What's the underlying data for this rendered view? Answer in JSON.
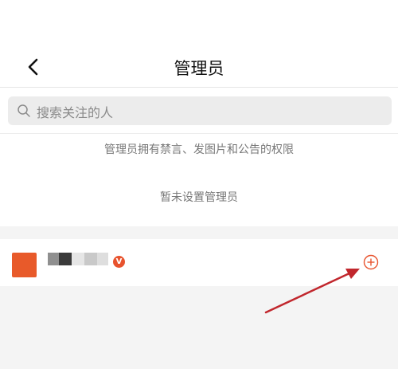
{
  "header": {
    "title": "管理员",
    "back_icon": "chevron-left-icon"
  },
  "search": {
    "placeholder": "搜索关注的人",
    "icon": "search-icon"
  },
  "info": {
    "permission_text": "管理员拥有禁言、发图片和公告的权限",
    "empty_text": "暂未设置管理员"
  },
  "member": {
    "verified_label": "V",
    "add_icon": "plus-circle-icon"
  },
  "colors": {
    "accent": "#e8532e",
    "avatar": "#e85a2a",
    "annotation_arrow": "#c1272d",
    "background": "#f4f4f4"
  }
}
